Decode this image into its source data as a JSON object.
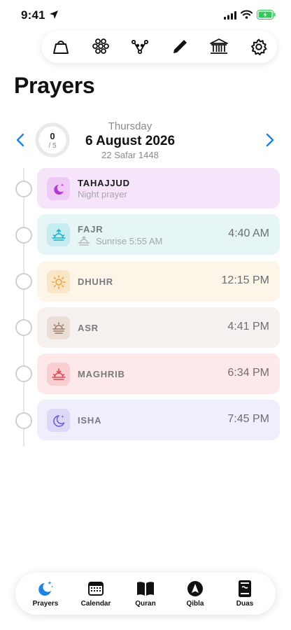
{
  "status_bar": {
    "time": "9:41"
  },
  "toolbar": {
    "items": [
      {
        "name": "mosque-bell-icon"
      },
      {
        "name": "tasbih-icon"
      },
      {
        "name": "nodes-icon"
      },
      {
        "name": "pen-icon"
      },
      {
        "name": "institution-icon"
      },
      {
        "name": "settings-icon"
      }
    ]
  },
  "page": {
    "title": "Prayers"
  },
  "date": {
    "weekday": "Thursday",
    "gregorian": "6 August 2026",
    "hijri": "22 Safar 1448",
    "completed": "0",
    "total": "/ 5",
    "completed_fraction": 0
  },
  "prayers": [
    {
      "name": "TAHAJJUD",
      "subtitle": "Night prayer",
      "time": "",
      "icon": "moon-star-icon",
      "bg": "#f6e4fb",
      "icon_bg": "#efcaf7",
      "icon_color": "#b538d9",
      "name_color": "#1a1a1a"
    },
    {
      "name": "FAJR",
      "subtitle": "Sunrise 5:55 AM",
      "time": "4:40 AM",
      "icon": "sunrise-icon",
      "bg": "#e6f6f7",
      "icon_bg": "#c6ecef",
      "icon_color": "#21b3c4",
      "name_color": "#7a7a7e"
    },
    {
      "name": "DHUHR",
      "subtitle": "",
      "time": "12:15 PM",
      "icon": "sun-icon",
      "bg": "#fcf5e8",
      "icon_bg": "#f8e6c6",
      "icon_color": "#eaa13a",
      "name_color": "#7a7a7e"
    },
    {
      "name": "ASR",
      "subtitle": "",
      "time": "4:41 PM",
      "icon": "sun-low-icon",
      "bg": "#f6f1ee",
      "icon_bg": "#ebded6",
      "icon_color": "#9c7a66",
      "name_color": "#7a7a7e"
    },
    {
      "name": "MAGHRIB",
      "subtitle": "",
      "time": "6:34 PM",
      "icon": "sunset-icon",
      "bg": "#fde9ea",
      "icon_bg": "#f9cfd2",
      "icon_color": "#e24a55",
      "name_color": "#7a7a7e"
    },
    {
      "name": "ISHA",
      "subtitle": "",
      "time": "7:45 PM",
      "icon": "moon-icon",
      "bg": "#efeefc",
      "icon_bg": "#dcd9f7",
      "icon_color": "#6d5fe0",
      "name_color": "#7a7a7e"
    }
  ],
  "tabs": [
    {
      "label": "Prayers",
      "icon": "moon-stars-icon",
      "active": true
    },
    {
      "label": "Calendar",
      "icon": "calendar-icon",
      "active": false
    },
    {
      "label": "Quran",
      "icon": "book-open-icon",
      "active": false
    },
    {
      "label": "Qibla",
      "icon": "compass-icon",
      "active": false
    },
    {
      "label": "Duas",
      "icon": "prayer-book-icon",
      "active": false
    }
  ],
  "colors": {
    "accent": "#1a84e8"
  }
}
